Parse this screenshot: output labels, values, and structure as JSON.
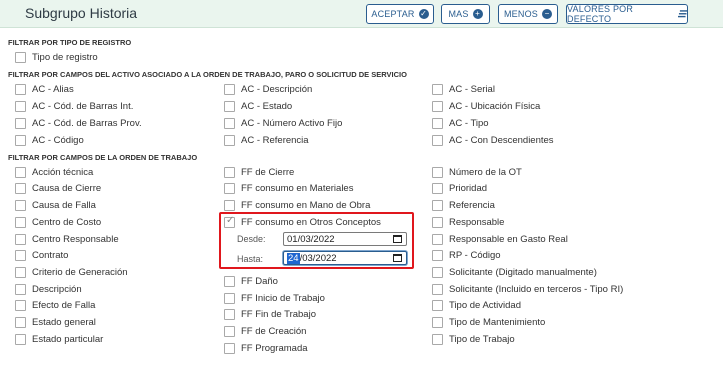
{
  "header": {
    "title": "Subgrupo Historia",
    "buttons": {
      "aceptar": "ACEPTAR",
      "mas": "MAS",
      "menos": "MENOS",
      "valores": "VALORES POR DEFECTO"
    }
  },
  "sections": {
    "tipo_registro": "FILTRAR POR TIPO DE REGISTRO",
    "activo": "FILTRAR POR CAMPOS DEL ACTIVO ASOCIADO A LA ORDEN DE TRABAJO, PARO O SOLICITUD DE SERVICIO",
    "orden": "FILTRAR POR CAMPOS DE LA ORDEN DE TRABAJO"
  },
  "tipo_registro": [
    "Tipo de registro"
  ],
  "activo": {
    "col1": [
      "AC - Alias",
      "AC - Cód. de Barras Int.",
      "AC - Cód. de Barras Prov.",
      "AC - Código"
    ],
    "col2": [
      "AC - Descripción",
      "AC - Estado",
      "AC - Número Activo Fijo",
      "AC - Referencia"
    ],
    "col3": [
      "AC - Serial",
      "AC - Ubicación Física",
      "AC - Tipo",
      "AC - Con Descendientes"
    ]
  },
  "orden": {
    "col1": [
      "Acción técnica",
      "Causa de Cierre",
      "Causa de Falla",
      "Centro de Costo",
      "Centro Responsable",
      "Contrato",
      "Criterio de Generación",
      "Descripción",
      "Efecto de Falla",
      "Estado general",
      "Estado particular"
    ],
    "col2_top": [
      "FF de Cierre",
      "FF consumo en Materiales",
      "FF consumo en Mano de Obra"
    ],
    "col2_checked": "FF consumo en Otros Conceptos",
    "col2_bottom": [
      "FF Daño",
      "FF Inicio de Trabajo",
      "FF Fin de Trabajo",
      "FF de Creación",
      "FF Programada"
    ],
    "col3": [
      "Número de la OT",
      "Prioridad",
      "Referencia",
      "Responsable",
      "Responsable en Gasto Real",
      "RP - Código",
      "Solicitante (Digitado manualmente)",
      "Solicitante (Incluido en terceros - Tipo RI)",
      "Tipo de Actividad",
      "Tipo de Mantenimiento",
      "Tipo de Trabajo"
    ]
  },
  "date_filter": {
    "desde_label": "Desde:",
    "desde_value": "01/03/2022",
    "hasta_label": "Hasta:",
    "hasta_selected": "24",
    "hasta_rest": "/03/2022"
  }
}
